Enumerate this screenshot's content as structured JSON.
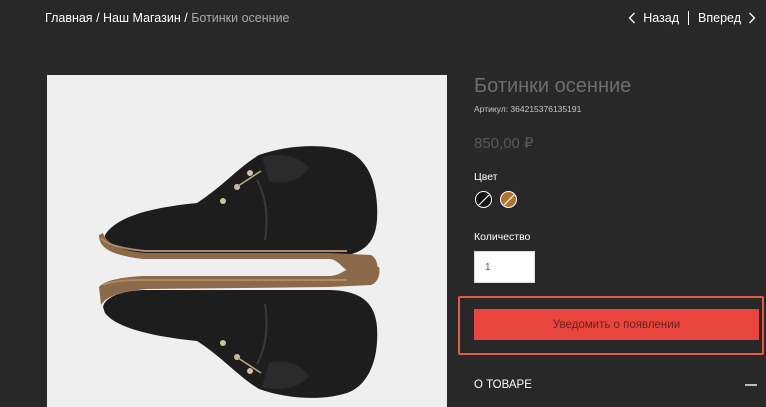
{
  "breadcrumb": {
    "home": "Главная",
    "separator": "/",
    "store": "Наш Магазин",
    "current": "Ботинки осенние"
  },
  "pager": {
    "back_label": "Назад",
    "forward_label": "Вперед",
    "back_icon": "chevron-left-icon",
    "forward_icon": "chevron-right-icon"
  },
  "product": {
    "title": "Ботинки осенние",
    "sku": "Артикул: 364215376135191",
    "price": "850,00 ₽",
    "color_label": "Цвет",
    "colors": [
      {
        "name": "black",
        "hex": "#111111",
        "selected": true
      },
      {
        "name": "brown",
        "hex": "#b5722c",
        "selected": false
      }
    ],
    "quantity_label": "Количество",
    "quantity_value": "1",
    "notify_button": "Уведомить о появлении",
    "about_label": "О ТОВАРЕ",
    "about_toggle_icon": "minus-icon",
    "image": "boots-photo"
  },
  "colors": {
    "background": "#282828",
    "accent": "#e8453f",
    "highlight": "#e35b48"
  }
}
